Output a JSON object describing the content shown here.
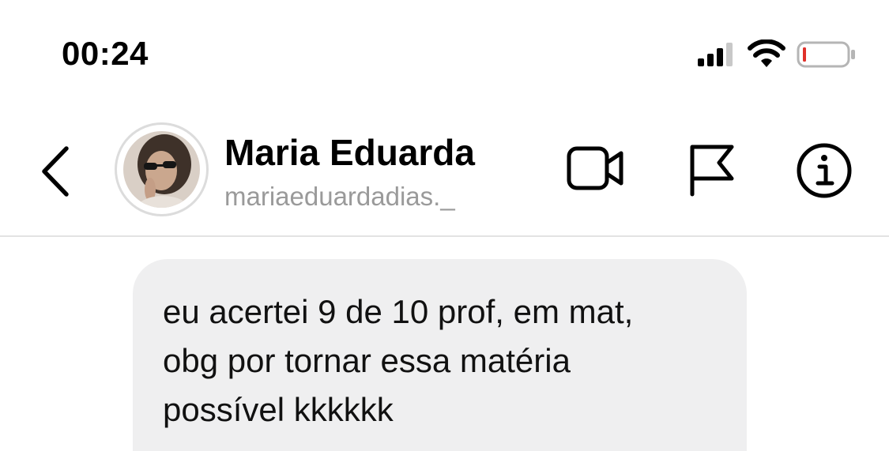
{
  "status_bar": {
    "time": "00:24"
  },
  "header": {
    "back_icon": "chevron-left-icon",
    "contact_name": "Maria Eduarda",
    "contact_username": "mariaeduardadias._",
    "actions": [
      "video-camera-icon",
      "flag-icon",
      "info-icon"
    ]
  },
  "conversation": {
    "messages": [
      {
        "direction": "incoming",
        "lines": [
          "eu acertei 9 de 10 prof, em mat,",
          "obg por tornar essa matéria",
          "possível kkkkkk"
        ]
      }
    ]
  },
  "colors": {
    "bubble_background": "#efeff0",
    "username_gray": "#9a9a9a",
    "battery_low": "#e0302a"
  }
}
